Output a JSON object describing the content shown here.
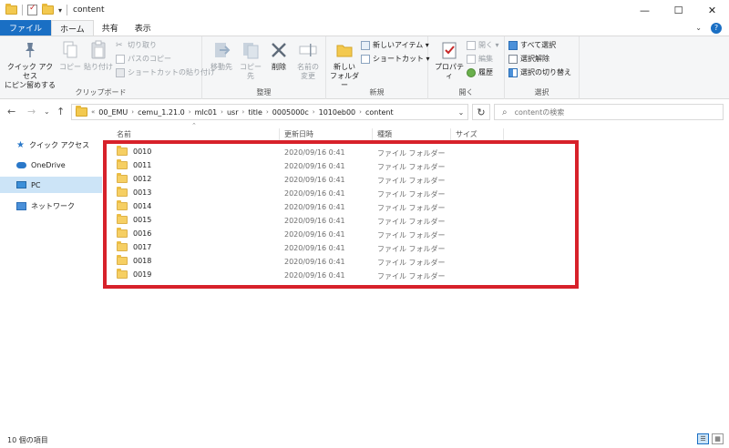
{
  "window": {
    "title": "content",
    "controls": [
      "—",
      "☐",
      "✕"
    ]
  },
  "ribbon_tabs": {
    "file": "ファイル",
    "home": "ホーム",
    "share": "共有",
    "view": "表示"
  },
  "ribbon": {
    "clipboard": {
      "pin": "クイック アクセス\nにピン留めする",
      "copy": "コピー",
      "paste": "貼り付け",
      "cut": "切り取り",
      "copy_path": "パスのコピー",
      "paste_shortcut": "ショートカットの貼り付け",
      "label": "クリップボード"
    },
    "organize": {
      "move_to": "移動先",
      "copy_to": "コピー先",
      "delete": "削除",
      "rename": "名前の\n変更",
      "label": "整理"
    },
    "new": {
      "new_folder": "新しい\nフォルダー",
      "new_item": "新しいアイテム ▾",
      "easy_access": "ショートカット ▾",
      "label": "新規"
    },
    "open": {
      "properties": "プロパティ",
      "open": "開く ▾",
      "edit": "編集",
      "history": "履歴",
      "label": "開く"
    },
    "select": {
      "select_all": "すべて選択",
      "select_none": "選択解除",
      "invert": "選択の切り替え",
      "label": "選択"
    }
  },
  "address": {
    "prefix": "«",
    "crumbs": [
      "00_EMU",
      "cemu_1.21.0",
      "mlc01",
      "usr",
      "title",
      "0005000c",
      "1010eb00",
      "content"
    ],
    "search_placeholder": "contentの検索"
  },
  "nav_pane": {
    "items": [
      {
        "label": "クイック アクセス",
        "icon": "star-icon"
      },
      {
        "label": "OneDrive",
        "icon": "cloud-icon"
      },
      {
        "label": "PC",
        "icon": "pc-icon"
      },
      {
        "label": "ネットワーク",
        "icon": "network-icon"
      }
    ]
  },
  "file_list": {
    "columns": {
      "name": "名前",
      "date": "更新日時",
      "type": "種類",
      "size": "サイズ"
    },
    "rows": [
      {
        "name": "0010",
        "date": "2020/09/16 0:41",
        "type": "ファイル フォルダー"
      },
      {
        "name": "0011",
        "date": "2020/09/16 0:41",
        "type": "ファイル フォルダー"
      },
      {
        "name": "0012",
        "date": "2020/09/16 0:41",
        "type": "ファイル フォルダー"
      },
      {
        "name": "0013",
        "date": "2020/09/16 0:41",
        "type": "ファイル フォルダー"
      },
      {
        "name": "0014",
        "date": "2020/09/16 0:41",
        "type": "ファイル フォルダー"
      },
      {
        "name": "0015",
        "date": "2020/09/16 0:41",
        "type": "ファイル フォルダー"
      },
      {
        "name": "0016",
        "date": "2020/09/16 0:41",
        "type": "ファイル フォルダー"
      },
      {
        "name": "0017",
        "date": "2020/09/16 0:41",
        "type": "ファイル フォルダー"
      },
      {
        "name": "0018",
        "date": "2020/09/16 0:41",
        "type": "ファイル フォルダー"
      },
      {
        "name": "0019",
        "date": "2020/09/16 0:41",
        "type": "ファイル フォルダー"
      }
    ]
  },
  "status": {
    "item_count": "10 個の項目"
  },
  "colors": {
    "accent": "#1a6fc4",
    "highlight_box": "#d7212a",
    "folder": "#f6cf63",
    "selected_nav": "#cce4f7"
  }
}
